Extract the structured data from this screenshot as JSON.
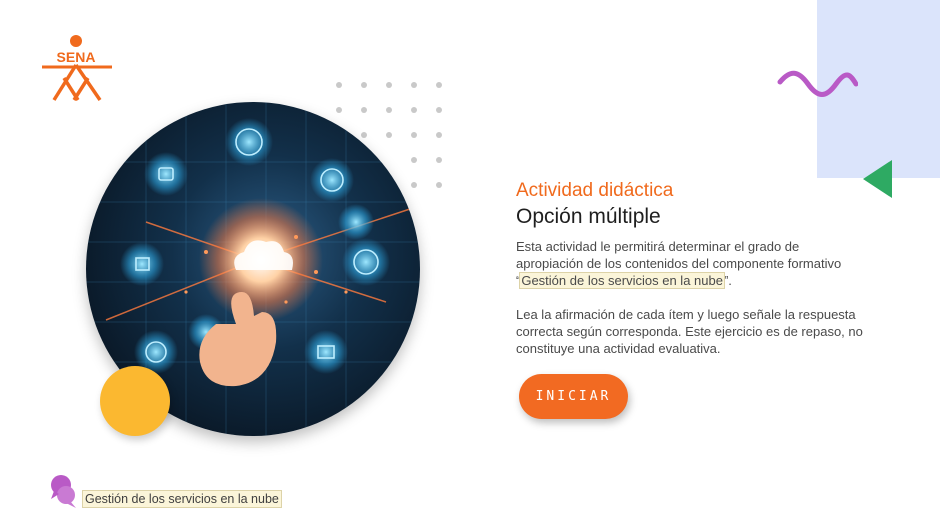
{
  "logo": {
    "text": "SENA",
    "color": "#f06a1d"
  },
  "activity": {
    "kicker": "Actividad didáctica",
    "title": "Opción múltiple",
    "paragraph1_before": "Esta actividad le permitirá determinar el grado de apropiación de los contenidos del componente formativo “",
    "paragraph1_highlight": "Gestión de los servicios en la nube",
    "paragraph1_after": "”.",
    "paragraph2": "Lea la afirmación de cada ítem y luego señale la respuesta correcta según corresponda.  Este ejercicio es de repaso, no constituye una actividad evaluativa.",
    "start_button": "INICIAR"
  },
  "footer": {
    "label": "Gestión de los servicios en la nube",
    "icon": "chat-bubbles-icon"
  },
  "decor": {
    "image": "cloud-technology-hand-icon",
    "accent_orange": "#f06a1d",
    "accent_yellow": "#fbb830",
    "accent_green": "#2eaa63",
    "accent_purple": "#b95ac6",
    "panel_blue": "#dbe4fb"
  }
}
